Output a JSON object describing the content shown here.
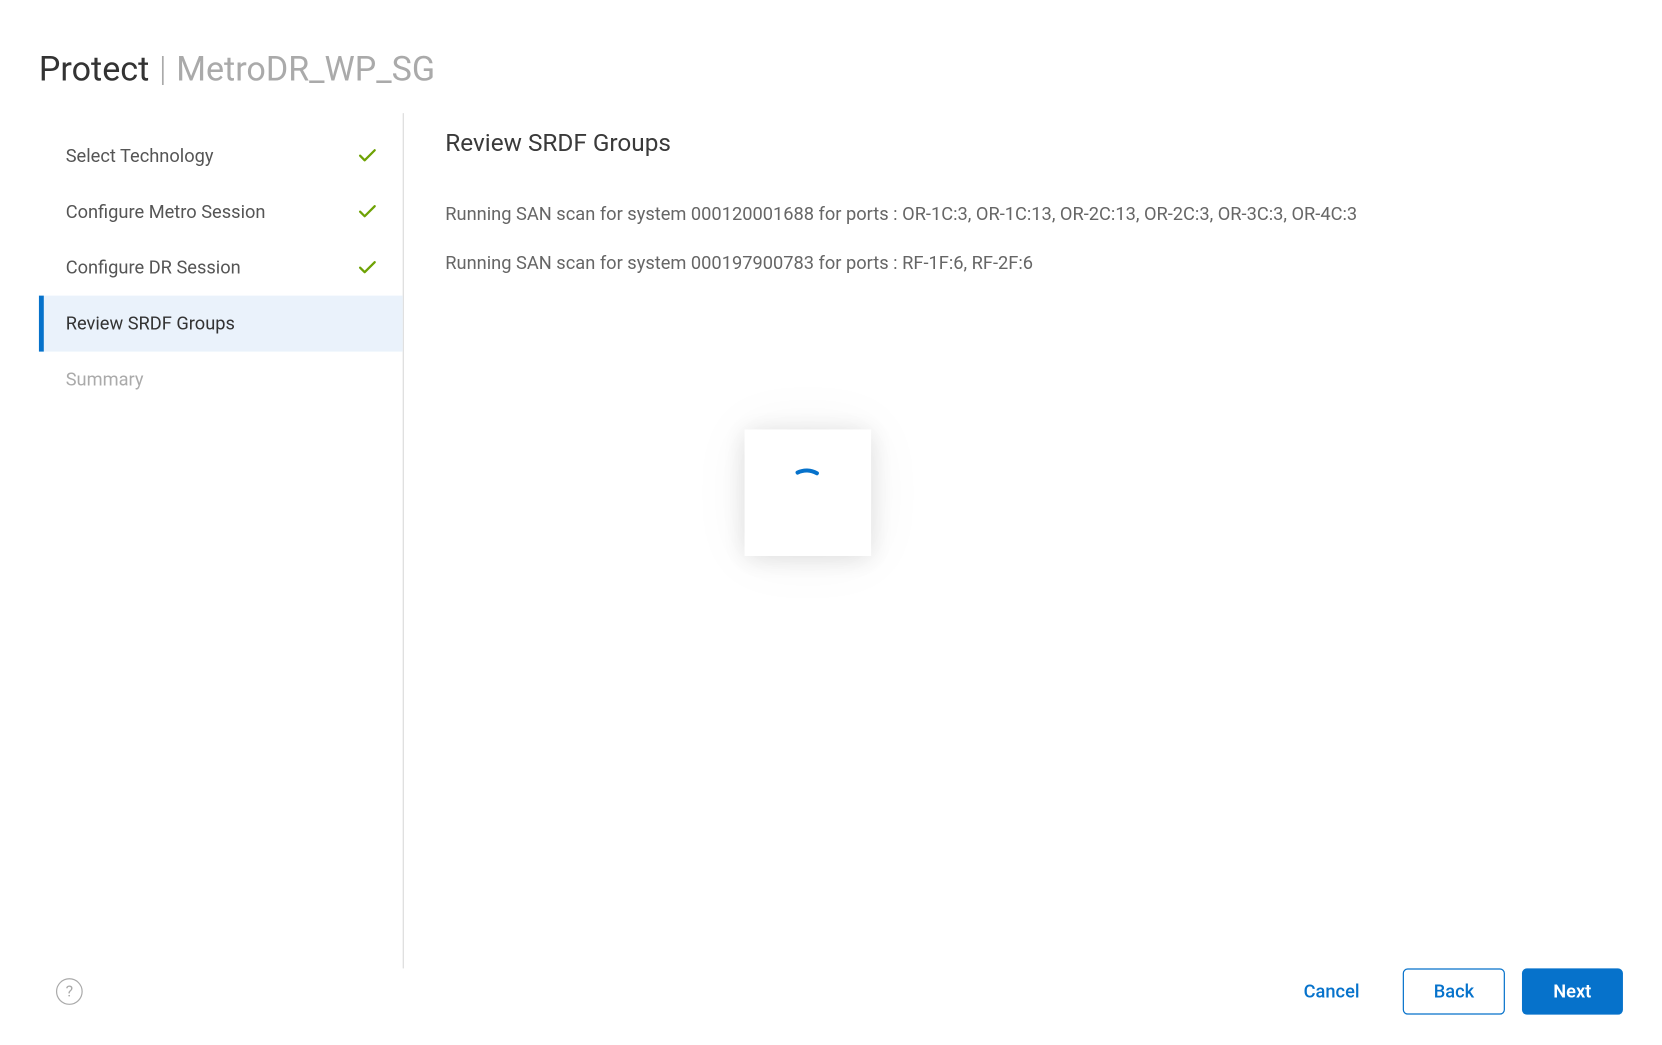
{
  "header": {
    "title": "Protect",
    "divider": "|",
    "subtitle": "MetroDR_WP_SG"
  },
  "steps": [
    {
      "label": "Select Technology",
      "state": "completed"
    },
    {
      "label": "Configure Metro Session",
      "state": "completed"
    },
    {
      "label": "Configure DR Session",
      "state": "completed"
    },
    {
      "label": "Review SRDF Groups",
      "state": "active"
    },
    {
      "label": "Summary",
      "state": "pending"
    }
  ],
  "main": {
    "title": "Review SRDF Groups",
    "status_lines": [
      "Running SAN scan for system 000120001688 for ports : OR-1C:3, OR-1C:13, OR-2C:13, OR-2C:3, OR-3C:3, OR-4C:3",
      "Running SAN scan for system 000197900783 for ports : RF-1F:6, RF-2F:6"
    ]
  },
  "footer": {
    "help_glyph": "?",
    "cancel": "Cancel",
    "back": "Back",
    "next": "Next"
  },
  "colors": {
    "primary": "#0672cb",
    "success": "#6ea204"
  }
}
